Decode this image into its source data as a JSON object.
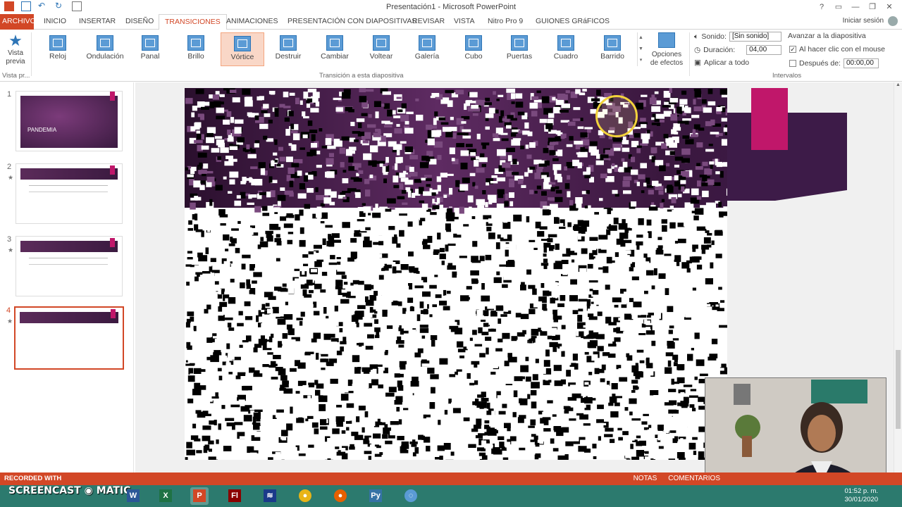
{
  "window": {
    "title": "Presentación1 - Microsoft PowerPoint",
    "controls": [
      "?",
      "▭",
      "—",
      "❐",
      "✕"
    ]
  },
  "tabs": [
    {
      "label": "ARCHIVO"
    },
    {
      "label": "INICIO"
    },
    {
      "label": "INSERTAR"
    },
    {
      "label": "DISEÑO"
    },
    {
      "label": "TRANSICIONES"
    },
    {
      "label": "ANIMACIONES"
    },
    {
      "label": "PRESENTACIÓN CON DIAPOSITIVAS"
    },
    {
      "label": "REVISAR"
    },
    {
      "label": "VISTA"
    },
    {
      "label": "Nitro Pro 9"
    },
    {
      "label": "GUIONES GRáFICOS"
    }
  ],
  "signin": "Iniciar sesión",
  "ribbon": {
    "preview_label": "Vista previa",
    "preview_group": "Vista pr...",
    "transitions": [
      {
        "label": "Reloj"
      },
      {
        "label": "Ondulación"
      },
      {
        "label": "Panal"
      },
      {
        "label": "Brillo"
      },
      {
        "label": "Vórtice"
      },
      {
        "label": "Destruir"
      },
      {
        "label": "Cambiar"
      },
      {
        "label": "Voltear"
      },
      {
        "label": "Galería"
      },
      {
        "label": "Cubo"
      },
      {
        "label": "Puertas"
      },
      {
        "label": "Cuadro"
      },
      {
        "label": "Barrido"
      }
    ],
    "selected_transition": "Vórtice",
    "effect_options": "Opciones de efectos",
    "transition_group": "Transición a esta diapositiva",
    "sound_label": "Sonido:",
    "sound_value": "[Sin sonido]",
    "duration_label": "Duración:",
    "duration_value": "04,00",
    "apply_all": "Aplicar a todo",
    "advance_title": "Avanzar a la diapositiva",
    "on_click": "Al hacer clic con el mouse",
    "on_click_checked": true,
    "after_label": "Después de:",
    "after_value": "00:00,00",
    "timing_group": "Intervalos"
  },
  "slides": [
    {
      "num": "1",
      "title": "PANDEMIA"
    },
    {
      "num": "2"
    },
    {
      "num": "3"
    },
    {
      "num": "4"
    }
  ],
  "statusbar": {
    "recorded": "RECORDED WITH",
    "notes": "NOTAS",
    "comments": "COMENTARIOS"
  },
  "taskbar": {
    "screencast": "SCREENCAST",
    "matic": "MATIC",
    "time": "01:52 p. m.",
    "date": "30/01/2020"
  },
  "colors": {
    "accent": "#d24726",
    "banner": "#5e2b62",
    "pink": "#c0176a",
    "taskbar": "#2c7a6e"
  }
}
